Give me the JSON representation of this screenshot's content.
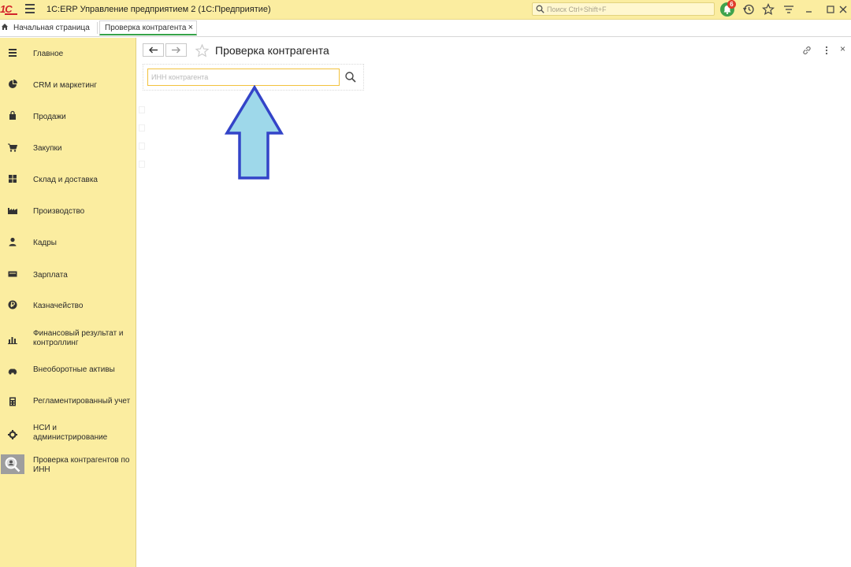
{
  "titlebar": {
    "logo_text": "1С",
    "app_title": "1C:ERP Управление предприятием 2  (1С:Предприятие)",
    "search_placeholder": "Поиск Ctrl+Shift+F",
    "notification_count": "6",
    "icons": [
      "menu-icon",
      "notifications-icon",
      "history-icon",
      "favorites-icon",
      "functions-icon",
      "minimize-icon",
      "maximize-icon",
      "close-icon"
    ]
  },
  "tabs": {
    "home_label": "Начальная страница",
    "active_label": "Проверка контрагента",
    "active_close": "×"
  },
  "sidebar": {
    "items": [
      {
        "label": "Главное",
        "icon": "menu-lines-icon"
      },
      {
        "label": "CRM и маркетинг",
        "icon": "pie-chart-icon"
      },
      {
        "label": "Продажи",
        "icon": "shopping-bag-icon"
      },
      {
        "label": "Закупки",
        "icon": "cart-icon"
      },
      {
        "label": "Склад и доставка",
        "icon": "warehouse-grid-icon"
      },
      {
        "label": "Производство",
        "icon": "factory-icon"
      },
      {
        "label": "Кадры",
        "icon": "person-icon"
      },
      {
        "label": "Зарплата",
        "icon": "wallet-icon"
      },
      {
        "label": "Казначейство",
        "icon": "ruble-coin-icon"
      },
      {
        "label": "Финансовый результат и контроллинг",
        "icon": "bar-chart-icon"
      },
      {
        "label": "Внеоборотные активы",
        "icon": "car-icon"
      },
      {
        "label": "Регламентированный учет",
        "icon": "calculator-icon"
      },
      {
        "label": "НСИ и администрирование",
        "icon": "gear-icon"
      },
      {
        "label": "Проверка контрагентов по ИНН",
        "icon": "search-document-icon"
      }
    ],
    "selected_index": 13
  },
  "form": {
    "title": "Проверка контрагента",
    "inn_placeholder": "ИНН контрагента",
    "inn_value": "",
    "close_symbol": "×"
  },
  "colors": {
    "panel_yellow": "#fbeda0",
    "input_focus_border": "#f2c23d",
    "tab_accent_green": "#37a34a",
    "arrow_fill": "#9ed8ea",
    "arrow_stroke": "#3344c8"
  }
}
